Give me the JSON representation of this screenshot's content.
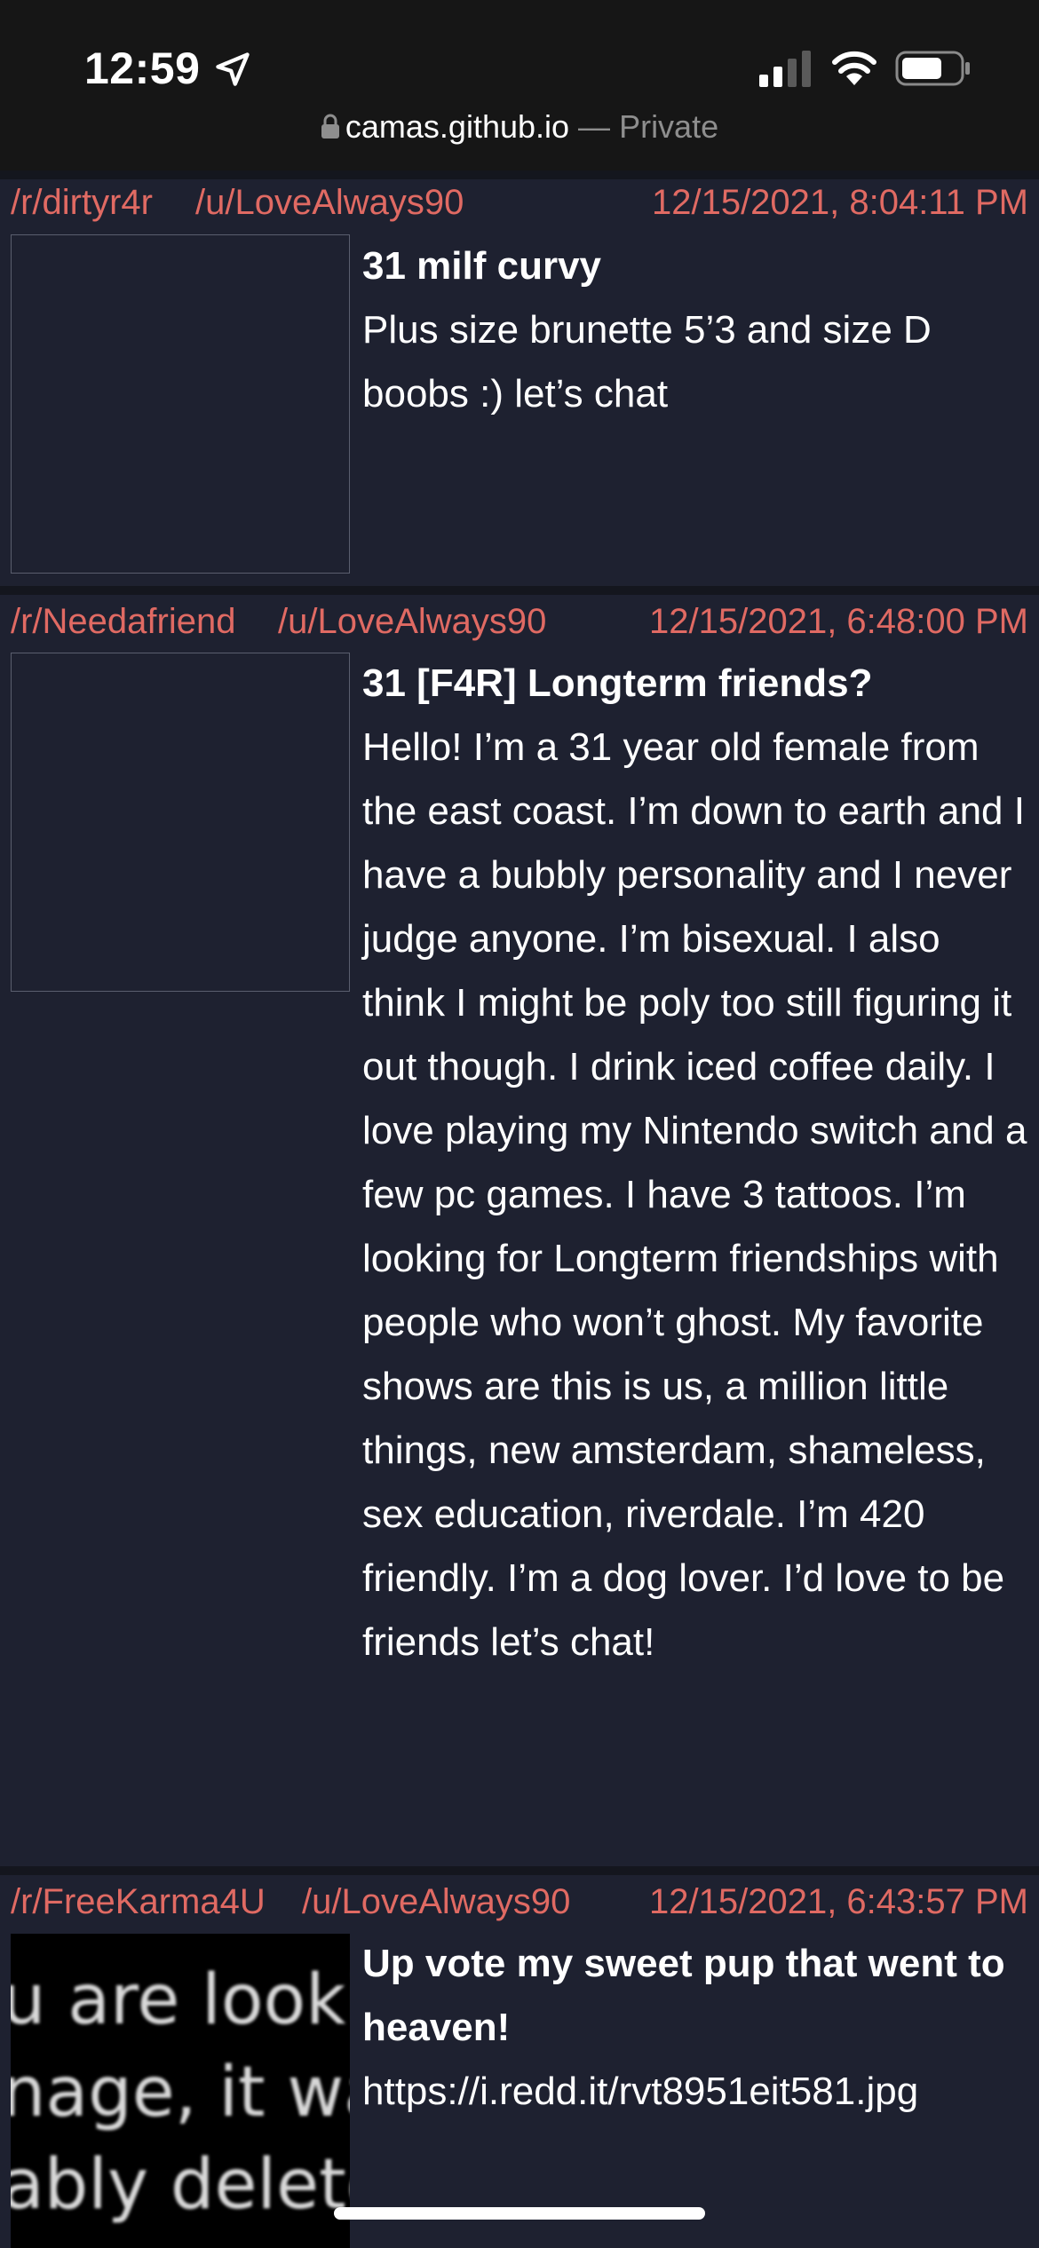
{
  "status_bar": {
    "time": "12:59",
    "icons": [
      "location-arrow-icon",
      "cell-signal-icon",
      "wifi-icon",
      "battery-icon"
    ]
  },
  "browser": {
    "url": "camas.github.io",
    "separator": "—",
    "mode": "Private"
  },
  "colors": {
    "accent": "#e06a63",
    "background": "#1e2130",
    "text": "#ffffff"
  },
  "posts": [
    {
      "subreddit": "/r/dirtyr4r",
      "user": "/u/LoveAlways90",
      "date": "12/15/2021, 8:04:11 PM",
      "title": "31 milf curvy",
      "body": "Plus size brunette 5’3 and size D boobs :) let’s chat"
    },
    {
      "subreddit": "/r/Needafriend",
      "user": "/u/LoveAlways90",
      "date": "12/15/2021, 6:48:00 PM",
      "title": "31 [F4R] Longterm friends?",
      "body": "Hello! I’m a 31 year old female from the east coast. I’m down to earth and I have a bubbly personality and I never judge anyone. I’m bisexual. I also think I might be poly too still figuring it out though. I drink iced coffee daily. I love playing my Nintendo switch and a few pc games. I have 3 tattoos. I’m looking for Longterm friendships with people who won’t ghost. My favorite shows are this is us, a million little things, new amsterdam, shameless, sex education, riverdale. I’m 420 friendly. I’m a dog lover. I’d love to be friends let’s chat!"
    },
    {
      "subreddit": "/r/FreeKarma4U",
      "user": "/u/LoveAlways90",
      "date": "12/15/2021, 6:43:57 PM",
      "title": "Up vote my sweet pup that went to heaven!",
      "body": "https://i.redd.it/rvt8951eit581.jpg",
      "thumbnail_text": [
        "u are lookin",
        "nage, it was",
        "ably delete"
      ]
    }
  ]
}
